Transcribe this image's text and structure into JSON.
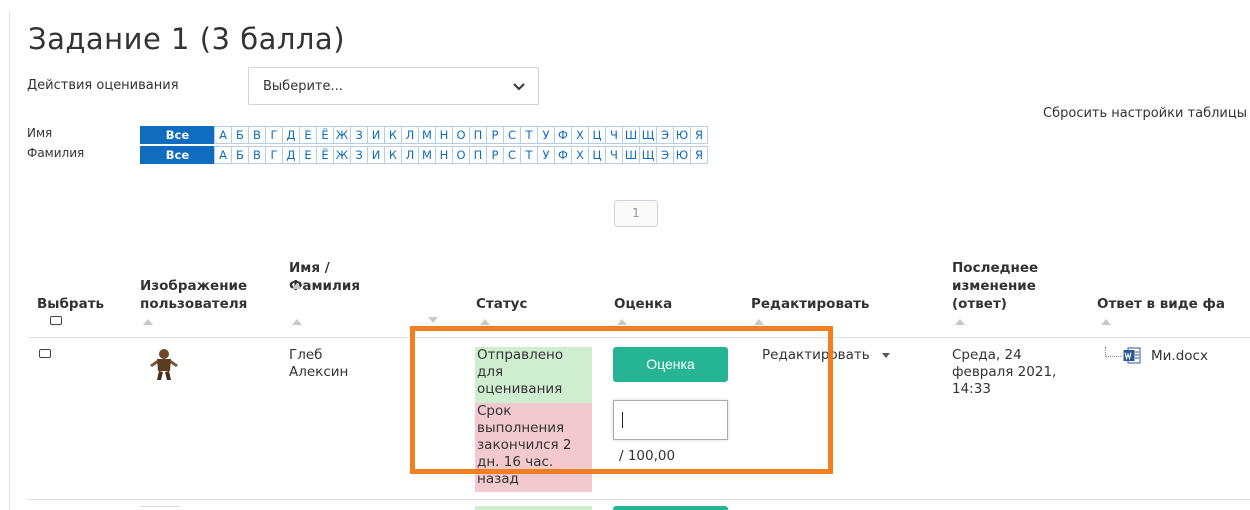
{
  "page": {
    "title": "Задание 1 (3 балла)"
  },
  "grading": {
    "label": "Действия оценивания",
    "select_value": "Выберите..."
  },
  "table_tools": {
    "reset_link": "Сбросить настройки таблицы"
  },
  "initials": {
    "first_name_label": "Имя",
    "last_name_label": "Фамилия",
    "all_label": "Все",
    "letters": [
      "А",
      "Б",
      "В",
      "Г",
      "Д",
      "Е",
      "Ё",
      "Ж",
      "З",
      "И",
      "К",
      "Л",
      "М",
      "Н",
      "О",
      "П",
      "Р",
      "С",
      "Т",
      "У",
      "Ф",
      "Х",
      "Ц",
      "Ч",
      "Ш",
      "Щ",
      "Э",
      "Ю",
      "Я"
    ]
  },
  "pagination": {
    "current_page": "1"
  },
  "table": {
    "headers": {
      "select": "Выбрать",
      "picture": "Изображение пользователя",
      "name": "Имя / Фамилия",
      "status": "Статус",
      "grade": "Оценка",
      "edit": "Редактировать",
      "modified": "Последнее изменение (ответ)",
      "file": "Ответ в виде фа"
    },
    "rows": [
      {
        "first_name": "Глеб",
        "last_name": "Алексин",
        "status_submitted": "Отправлено для оценивания",
        "status_overdue": "Срок выполнения закончился 2 дн. 16 час. назад",
        "grade_button": "Оценка",
        "grade_value": "",
        "grade_max": "/ 100,00",
        "edit_label": "Редактировать",
        "modified": "Среда, 24 февраля 2021, 14:33",
        "file_name": "Ми.docx"
      }
    ]
  },
  "colors": {
    "accent_blue": "#0f6cbf",
    "grade_button": "#26b594",
    "submitted_bg": "#cfeecf",
    "overdue_bg": "#f2c9cc",
    "highlight_frame": "#f47f20"
  }
}
